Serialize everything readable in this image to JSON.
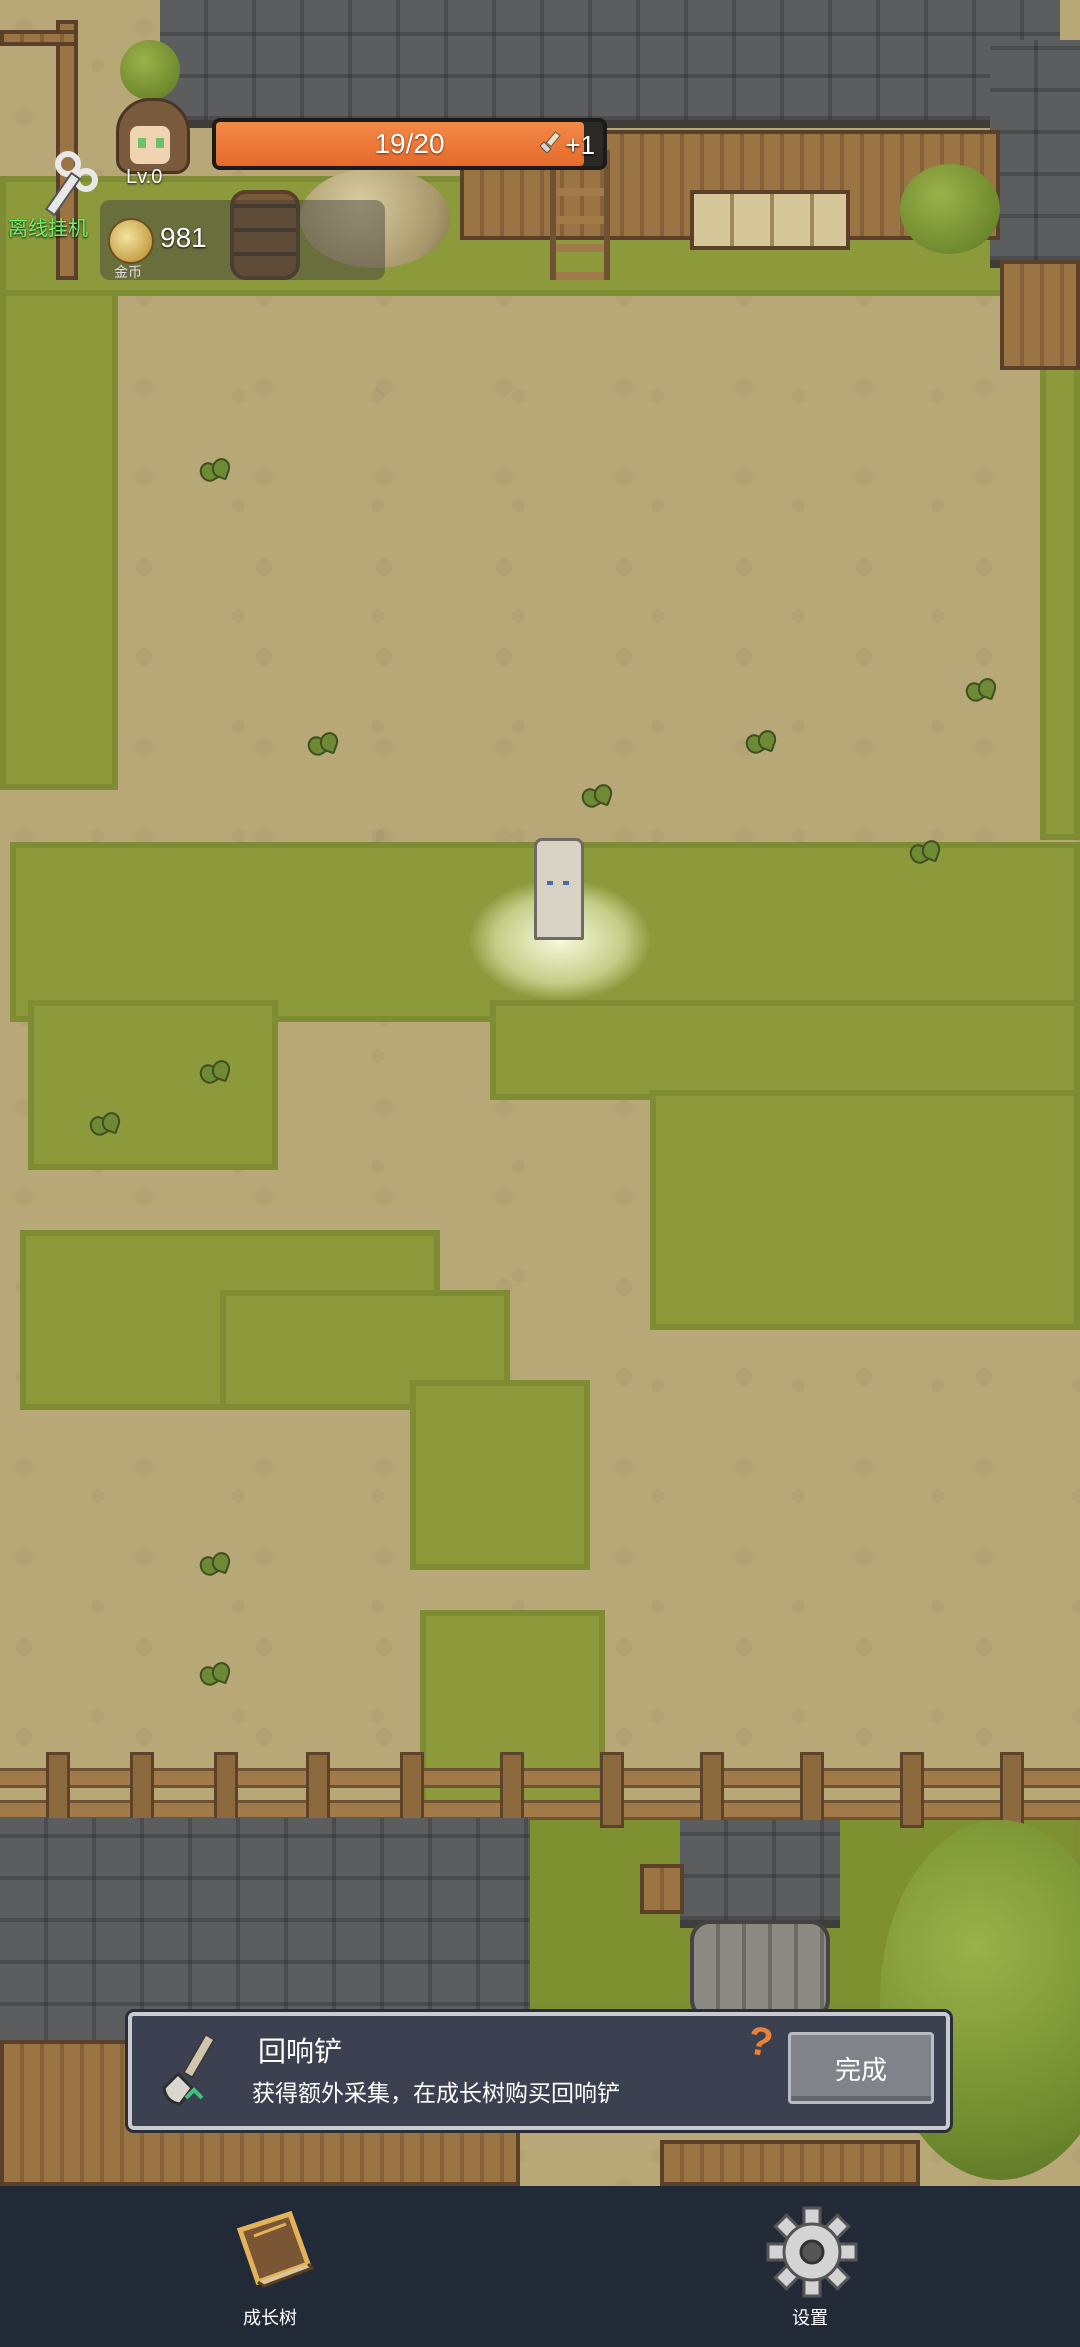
{
  "hud": {
    "level": "Lv.0",
    "xp_text": "19/20",
    "xp_fraction": 0.95,
    "xp_bonus": "+1",
    "gold": "981",
    "gold_label": "金币",
    "idle_label": "离线挂机"
  },
  "quest": {
    "title": "回响铲",
    "description": "获得额外采集，在成长树购买回响铲",
    "help_symbol": "?",
    "done_label": "完成"
  },
  "nav": {
    "growth_tree_label": "成长树",
    "settings_label": "设置"
  },
  "colors": {
    "xp_fill": "#e46a2a",
    "panel_bg": "#3b4150",
    "nav_bg": "#232a37",
    "idle_label": "#6cf56c",
    "grass": "#8c9a3c",
    "dirt": "#b8a878"
  },
  "icons": {
    "idle": "wind-up-key-icon",
    "coin": "gold-coin-icon",
    "xp_bonus": "shovel-icon",
    "quest": "shovel-icon",
    "growth_tree": "book-icon",
    "settings": "gear-icon",
    "help": "question-mark-icon"
  }
}
